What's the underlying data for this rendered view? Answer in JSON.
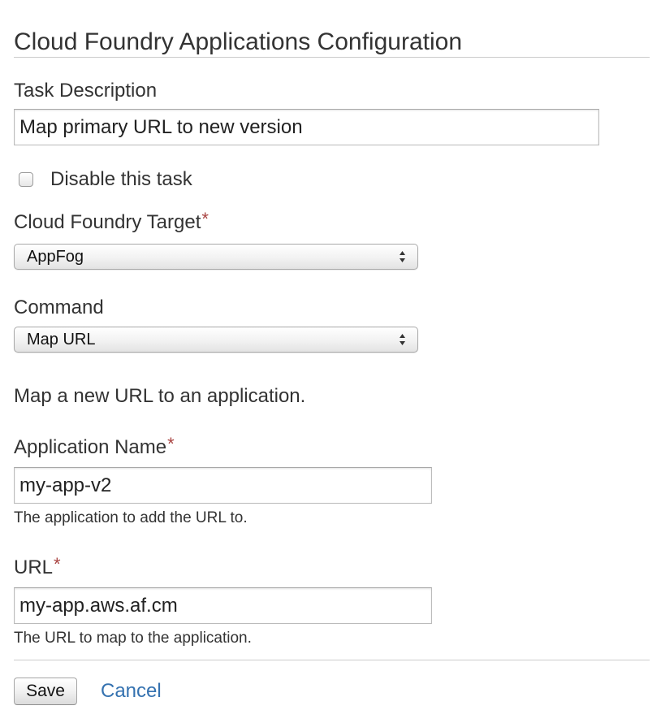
{
  "form": {
    "title": "Cloud Foundry Applications Configuration",
    "required_marker": "*",
    "task_description": {
      "label": "Task Description",
      "value": "Map primary URL to new version"
    },
    "disable_task": {
      "label": "Disable this task",
      "checked": false
    },
    "target": {
      "label": "Cloud Foundry Target",
      "selected": "AppFog"
    },
    "command": {
      "label": "Command",
      "selected": "Map URL",
      "description": "Map a new URL to an application."
    },
    "application_name": {
      "label": "Application Name",
      "value": "my-app-v2",
      "help": "The application to add the URL to."
    },
    "url": {
      "label": "URL",
      "value": "my-app.aws.af.cm",
      "help": "The URL to map to the application."
    },
    "actions": {
      "save_label": "Save",
      "cancel_label": "Cancel"
    }
  },
  "colors": {
    "text": "#333333",
    "required": "#a94442",
    "link": "#3572b0",
    "rule": "#cccccc"
  },
  "icons": {
    "select_arrows": "up-down-arrows-icon"
  }
}
